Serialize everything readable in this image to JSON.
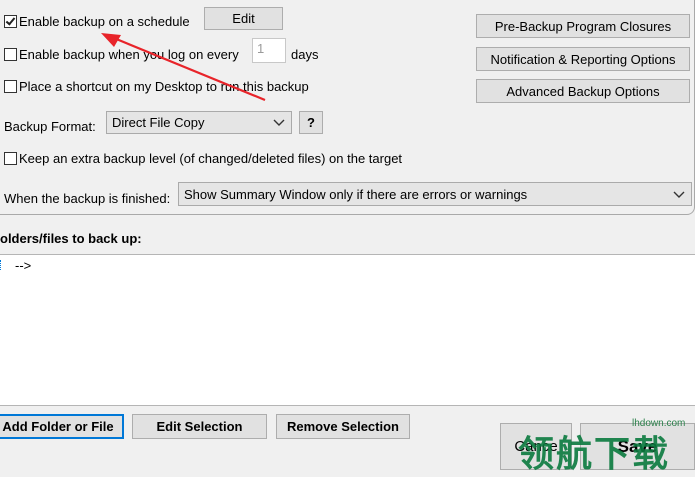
{
  "schedule": {
    "enable_label": "Enable backup on a schedule",
    "enable_checked": true,
    "edit_label": "Edit",
    "logon_label": "Enable backup when you log on every",
    "logon_checked": false,
    "days_value": "1",
    "days_label": "days",
    "shortcut_label": "Place a shortcut on my Desktop to run this backup",
    "shortcut_checked": false
  },
  "right_buttons": {
    "pre_backup": "Pre-Backup Program Closures",
    "notification": "Notification & Reporting Options",
    "advanced": "Advanced Backup Options"
  },
  "format": {
    "label": "Backup Format:",
    "value": "Direct File Copy",
    "help": "?"
  },
  "extra_level": {
    "label": "Keep an extra backup level (of changed/deleted files) on the target",
    "checked": false
  },
  "finished": {
    "label": "When the backup is finished:",
    "value": "Show Summary Window only if there are errors or warnings"
  },
  "files": {
    "title": "olders/files to back up:",
    "row_text": "-->"
  },
  "bottom_buttons": {
    "add": "Add Folder or File",
    "edit": "Edit Selection",
    "remove": "Remove Selection",
    "cancel": "Cance",
    "save": "Save"
  },
  "watermark": {
    "site": "lhdown.com",
    "cn": "领航下载"
  },
  "colors": {
    "arrow": "#e8242a",
    "focus": "#0078d7",
    "watermark": "#0b7a3f"
  }
}
